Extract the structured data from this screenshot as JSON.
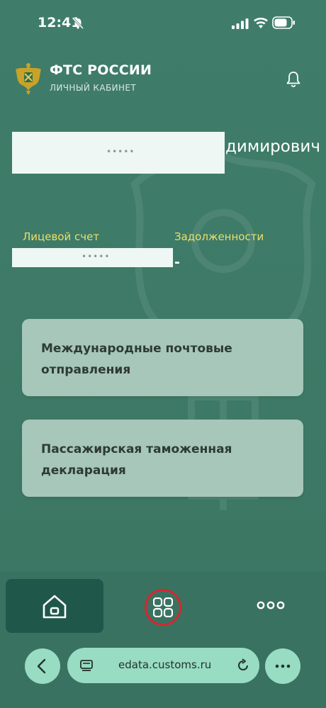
{
  "status_bar": {
    "time": "12:41"
  },
  "header": {
    "org_name": "ФТС РОССИИ",
    "org_subtitle": "ЛИЧНЫЙ КАБИНЕТ"
  },
  "user": {
    "name_visible_part": "димирович",
    "redacted_marker": "•••••"
  },
  "account": {
    "balance_label": "Лицевой счет",
    "balance_value": "",
    "debt_label": "Задолженности",
    "debt_value": "-",
    "redacted_marker": "•••••"
  },
  "services": [
    {
      "label": "Международные почтовые отправления"
    },
    {
      "label": "Пассажирская таможенная декларация"
    }
  ],
  "bottom_nav": {
    "items": [
      {
        "icon": "home-icon",
        "active": true
      },
      {
        "icon": "grid-icon",
        "active": false
      },
      {
        "icon": "more-dots-icon",
        "active": false
      }
    ]
  },
  "browser": {
    "url": "edata.customs.ru"
  },
  "colors": {
    "background": "#3f7c69",
    "accent_label": "#e9e06a",
    "card": "#a6c7ba",
    "nav_active": "#1f574b",
    "highlight_ring": "#d7262e",
    "browser_pill": "#98dcc3"
  }
}
